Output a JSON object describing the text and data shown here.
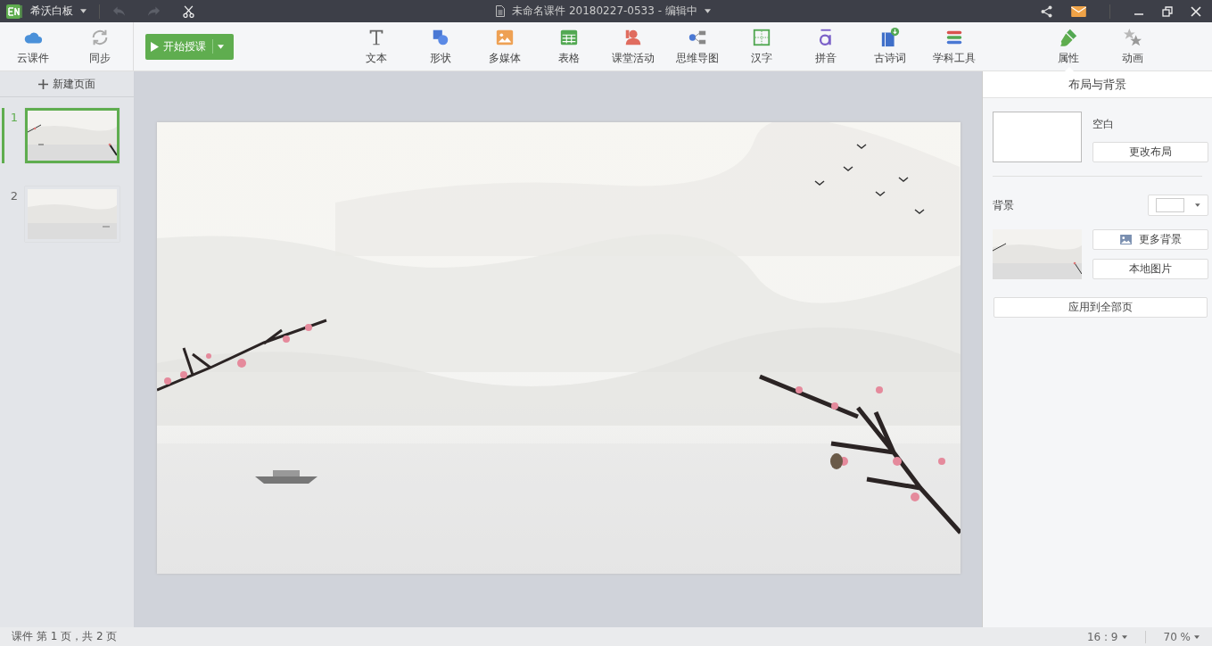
{
  "app": {
    "name": "希沃白板"
  },
  "window": {
    "title": "未命名课件 20180227-0533 - 编辑中"
  },
  "toolbar_left": [
    {
      "kind": "cloud",
      "label": "云课件"
    },
    {
      "kind": "sync",
      "label": "同步"
    }
  ],
  "start_button": {
    "label": "开始授课"
  },
  "tools": [
    {
      "kind": "text",
      "label": "文本"
    },
    {
      "kind": "shape",
      "label": "形状"
    },
    {
      "kind": "media",
      "label": "多媒体"
    },
    {
      "kind": "table",
      "label": "表格"
    },
    {
      "kind": "activity",
      "label": "课堂活动"
    },
    {
      "kind": "mindmap",
      "label": "思维导图"
    },
    {
      "kind": "hanzi",
      "label": "汉字"
    },
    {
      "kind": "pinyin",
      "label": "拼音"
    },
    {
      "kind": "poem",
      "label": "古诗词"
    },
    {
      "kind": "subject",
      "label": "学科工具"
    }
  ],
  "right_tabs": [
    {
      "kind": "brush",
      "label": "属性",
      "selected": true
    },
    {
      "kind": "stars",
      "label": "动画",
      "selected": false
    }
  ],
  "sidebar": {
    "new_page": "新建页面",
    "pages": [
      {
        "number": "1",
        "selected": true,
        "kind": "full"
      },
      {
        "number": "2",
        "selected": false,
        "kind": "plain"
      }
    ]
  },
  "panel": {
    "title": "布局与背景",
    "layout_label": "空白",
    "change_layout": "更改布局",
    "background_label": "背景",
    "more_backgrounds": "更多背景",
    "local_image": "本地图片",
    "apply_all": "应用到全部页"
  },
  "status_bar": {
    "page_info": "课件 第 1 页，共 2 页",
    "ratio": "16 : 9",
    "zoom": "70 %"
  }
}
